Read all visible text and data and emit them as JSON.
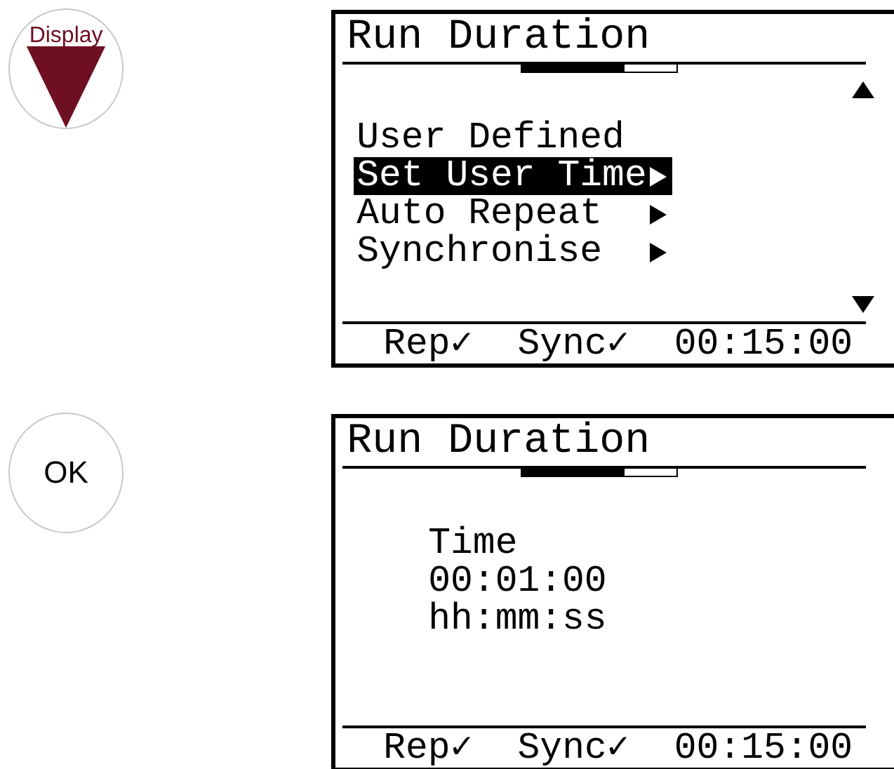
{
  "steps": [
    {
      "key": {
        "kind": "display",
        "label": "Display"
      },
      "screen": {
        "title": "Run Duration",
        "progress": {
          "level": 0.66
        },
        "scroll_arrows": true,
        "kind": "menu",
        "items": [
          {
            "label": "User Defined",
            "submenu": false,
            "selected": false
          },
          {
            "label": "Set User Time",
            "submenu": true,
            "selected": true
          },
          {
            "label": "Auto Repeat",
            "submenu": true,
            "selected": false
          },
          {
            "label": "Synchronise",
            "submenu": true,
            "selected": false
          }
        ],
        "footer": [
          "Rep✓",
          "Sync✓",
          "00:15:00"
        ]
      }
    },
    {
      "key": {
        "kind": "ok",
        "label": "OK"
      },
      "screen": {
        "title": "Run Duration",
        "progress": {
          "level": 0.66
        },
        "scroll_arrows": false,
        "kind": "field",
        "lines": [
          "Time",
          "00:01:00",
          "hh:mm:ss"
        ],
        "footer": [
          "Rep✓",
          "Sync✓",
          "00:15:00"
        ]
      }
    }
  ]
}
